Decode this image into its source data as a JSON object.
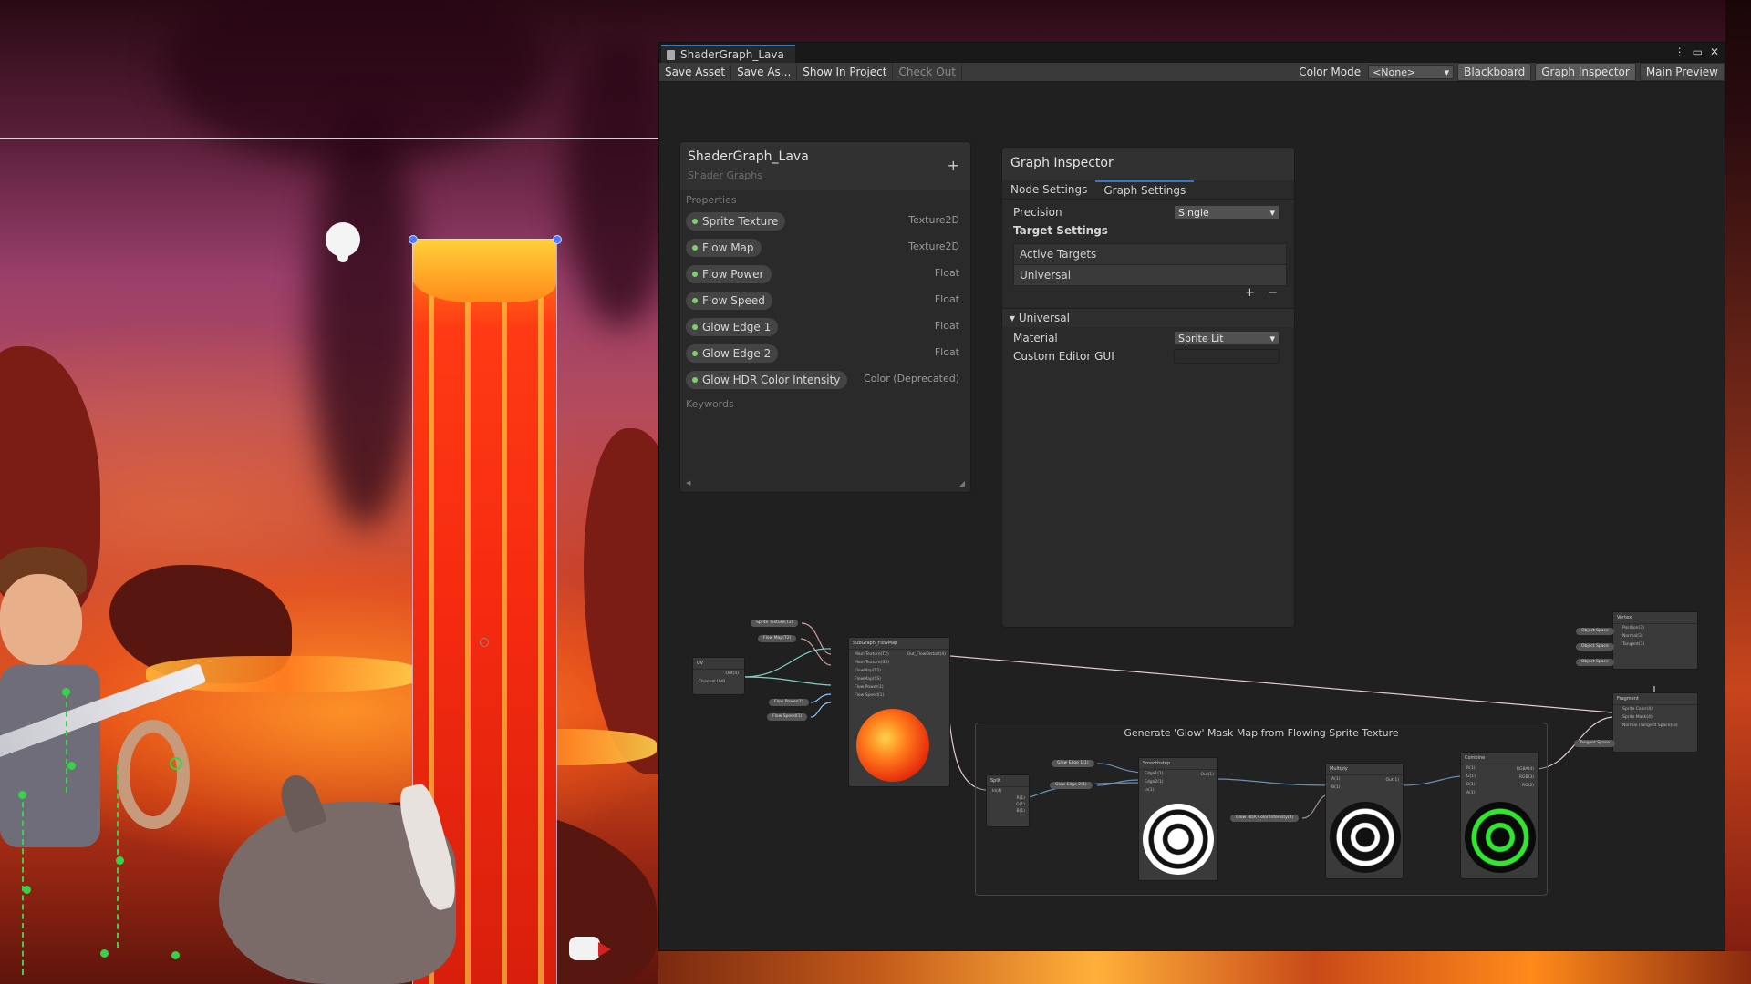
{
  "window": {
    "tab_title": "ShaderGraph_Lava",
    "controls": {
      "menu": "⋮",
      "maximize": "🗖",
      "close": "✕"
    }
  },
  "toolbar": {
    "save_asset": "Save Asset",
    "save_as": "Save As...",
    "show_in_project": "Show In Project",
    "check_out": "Check Out",
    "color_mode_label": "Color Mode",
    "color_mode_value": "<None>",
    "blackboard": "Blackboard",
    "graph_inspector": "Graph Inspector",
    "main_preview": "Main Preview"
  },
  "blackboard": {
    "title": "ShaderGraph_Lava",
    "subtitle": "Shader Graphs",
    "add": "+",
    "properties_label": "Properties",
    "keywords_label": "Keywords",
    "properties": [
      {
        "name": "Sprite Texture",
        "type": "Texture2D"
      },
      {
        "name": "Flow Map",
        "type": "Texture2D"
      },
      {
        "name": "Flow Power",
        "type": "Float"
      },
      {
        "name": "Flow Speed",
        "type": "Float"
      },
      {
        "name": "Glow Edge 1",
        "type": "Float"
      },
      {
        "name": "Glow Edge 2",
        "type": "Float"
      },
      {
        "name": "Glow HDR Color Intensity",
        "type": "Color (Deprecated)"
      }
    ]
  },
  "inspector": {
    "title": "Graph Inspector",
    "tabs": [
      "Node Settings",
      "Graph Settings"
    ],
    "active_tab": "Graph Settings",
    "precision_label": "Precision",
    "precision_value": "Single",
    "target_settings_label": "Target Settings",
    "active_targets_label": "Active Targets",
    "target_item": "Universal",
    "list_add": "+",
    "list_remove": "−",
    "universal_foldout": "Universal",
    "material_label": "Material",
    "material_value": "Sprite Lit",
    "custom_editor_label": "Custom Editor GUI"
  },
  "graph": {
    "group_title": "Generate 'Glow' Mask Map from Flowing Sprite Texture",
    "nodes": {
      "uv": {
        "title": "UV",
        "port": "Out(4)",
        "channel": "Channel  UV0"
      },
      "subgraph": {
        "title": "SubGraph_FlowMap",
        "ports": [
          "Main Texture(T2)",
          "Main Texture(SS)",
          "FlowMap(T2)",
          "FlowMap(SS)",
          "Flow Power(1)",
          "Flow Speed(1)"
        ],
        "out": "Out_FlowDistort(4)"
      },
      "split": {
        "title": "Split",
        "ports": [
          "In(4)",
          "R(1)",
          "G(1)",
          "B(1)",
          "A(1)"
        ]
      },
      "smoothstep": {
        "title": "Smoothstep",
        "ports": [
          "Edge1(1)",
          "Edge2(1)",
          "In(1)"
        ],
        "out": "Out(1)"
      },
      "multiply": {
        "title": "Multiply",
        "ports": [
          "A(1)",
          "B(1)"
        ],
        "out": "Out(1)"
      },
      "combine": {
        "title": "Combine",
        "ports": [
          "R(1)",
          "G(1)",
          "B(1)",
          "A(1)"
        ],
        "outs": [
          "RGBA(4)",
          "RGB(3)",
          "RG(2)"
        ]
      },
      "vertex": {
        "title": "Vertex",
        "ports": [
          "Position(3)",
          "Normal(3)",
          "Tangent(3)"
        ],
        "spaces": [
          "Object Space",
          "Object Space",
          "Object Space"
        ]
      },
      "fragment": {
        "title": "Fragment",
        "ports": [
          "Sprite Color(4)",
          "Sprite Mask(4)",
          "Normal (Tangent Space)(3)"
        ],
        "space": "Tangent Space"
      }
    },
    "pills": {
      "sprite_texture": "Sprite Texture(T2)",
      "flow_map": "Flow Map(T2)",
      "flow_power": "Flow Power(1)",
      "flow_speed": "Flow Speed(1)",
      "glow_edge_1": "Glow Edge 1(1)",
      "glow_edge_2": "Glow Edge 2(1)",
      "glow_hdr": "Glow HDR Color Intensity(4)"
    }
  },
  "colors": {
    "accent": "#3a79bb",
    "property_dot": "#7fcf6a",
    "bone": "#37d14a"
  },
  "icons": {
    "tab_icon": "shader-graph-icon",
    "light_icon": "light-bulb-icon",
    "camera_icon": "camera-gizmo-icon"
  }
}
